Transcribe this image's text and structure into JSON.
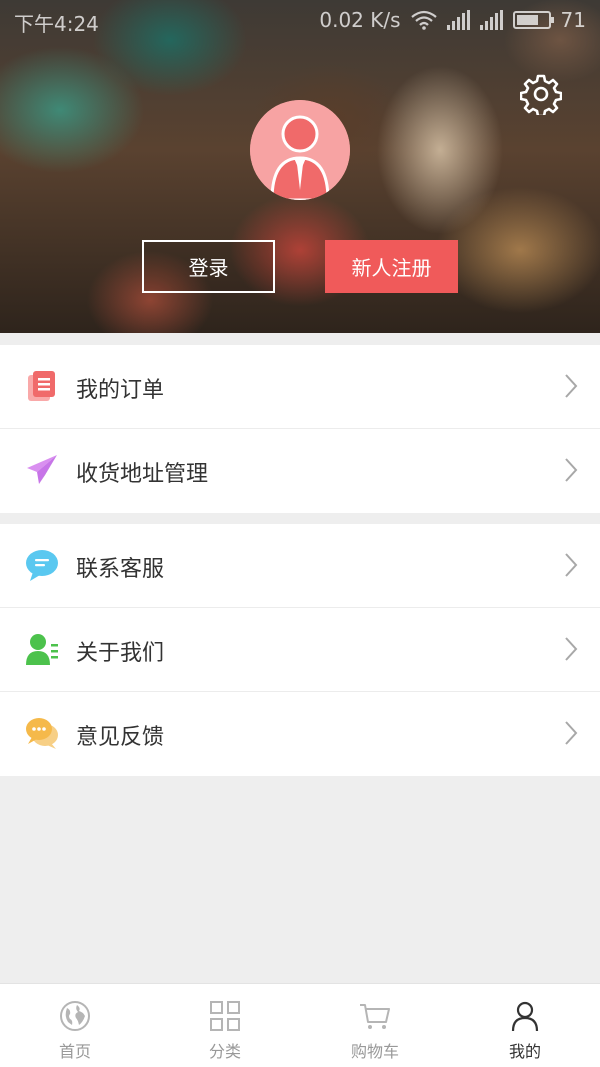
{
  "status_bar": {
    "time": "下午4:24",
    "speed": "0.02 K/s",
    "battery": "71"
  },
  "header": {
    "settings_icon": "gear-icon",
    "avatar_icon": "user-avatar-icon",
    "login_label": "登录",
    "register_label": "新人注册",
    "register_color": "#f05a5a"
  },
  "menu": {
    "group1": [
      {
        "label": "我的订单",
        "icon": "order-icon",
        "color": "#f06a6a"
      },
      {
        "label": "收货地址管理",
        "icon": "paper-plane-icon",
        "color": "#c774e8"
      }
    ],
    "group2": [
      {
        "label": "联系客服",
        "icon": "chat-bubble-icon",
        "color": "#5ac8f0"
      },
      {
        "label": "关于我们",
        "icon": "contact-icon",
        "color": "#4cc24c"
      },
      {
        "label": "意见反馈",
        "icon": "feedback-icon",
        "color": "#f5b94a"
      }
    ]
  },
  "bottom_nav": {
    "items": [
      {
        "label": "首页",
        "icon": "globe-icon"
      },
      {
        "label": "分类",
        "icon": "grid-icon"
      },
      {
        "label": "购物车",
        "icon": "cart-icon"
      },
      {
        "label": "我的",
        "icon": "person-icon",
        "active": true
      }
    ]
  }
}
